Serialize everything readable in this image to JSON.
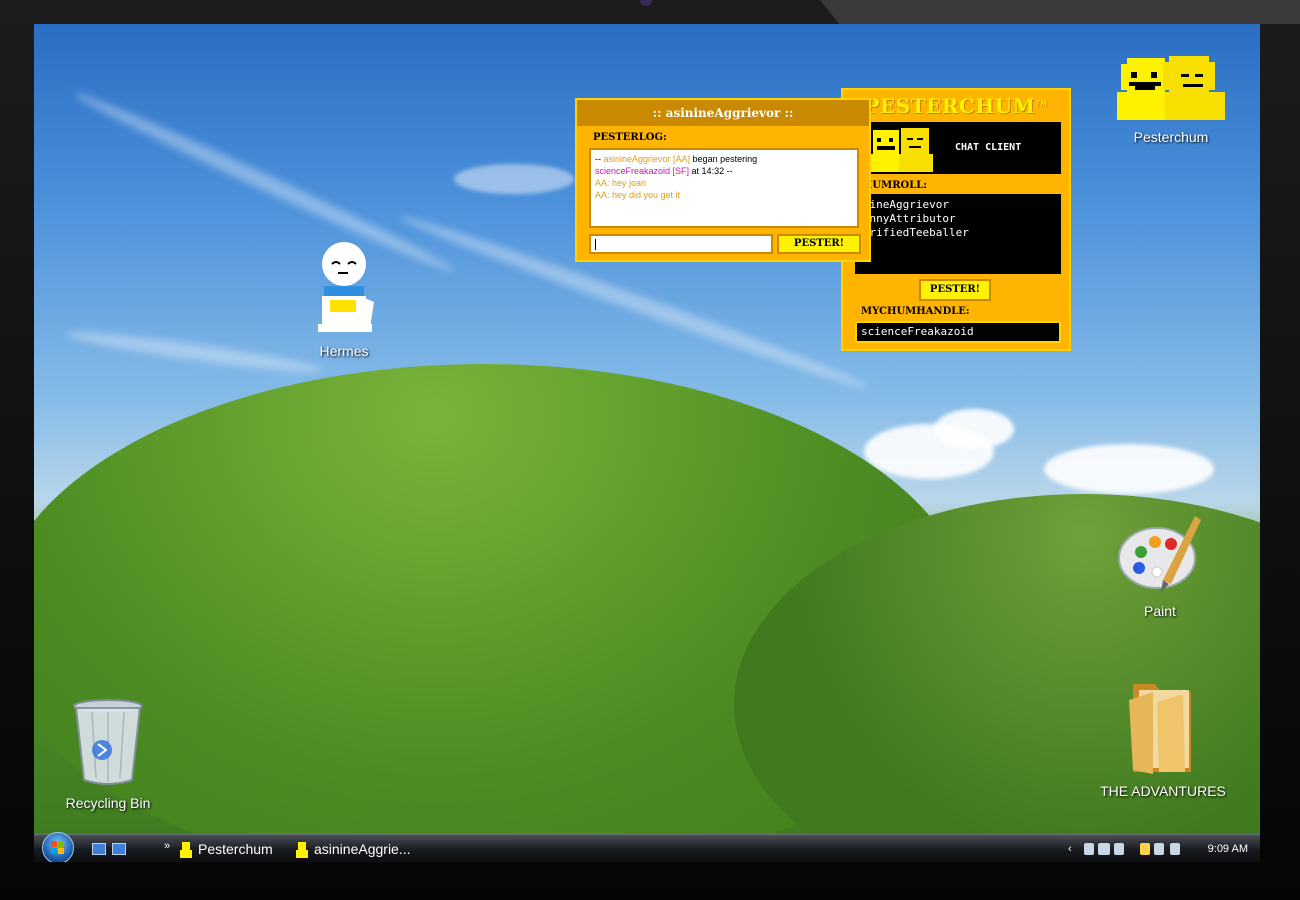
{
  "desktop": {
    "icons": [
      {
        "label": "Pesterchum",
        "icon": "pesterchum-icon"
      },
      {
        "label": "Hermes",
        "icon": "hermes-icon"
      },
      {
        "label": "Paint",
        "icon": "paint-palette-icon"
      },
      {
        "label": "Recycling Bin",
        "icon": "recycle-bin-icon"
      },
      {
        "label": "THE ADVANTURES",
        "icon": "folder-icon"
      }
    ]
  },
  "pesterchum": {
    "title": "PESTERCHUM",
    "title_tm": "TM",
    "subtitle": "CHAT CLIENT",
    "chumroll_label": "CHUMROLL:",
    "chums": [
      "asinineAggrievor",
      "uncannyAttributor",
      "centrifiedTeeballer"
    ],
    "pester_label": "PESTER!",
    "mychumhandle_label": "MYCHUMHANDLE:",
    "handle": "scienceFreakazoid"
  },
  "conversation": {
    "title": ":: asinineAggrievor ::",
    "pesterlog_label": "PESTERLOG:",
    "log": {
      "line1_prefix": "-- ",
      "line1_handle": "asinineAggrievor [AA]",
      "line1_text": " began pestering",
      "line2_handle": "scienceFreakazoid [SF]",
      "line2_text": " at 14:32 --",
      "msg1": "AA: hey joan",
      "msg2": "AA: hey did you get it"
    },
    "input_value": "",
    "pester_label": "PESTER!"
  },
  "taskbar": {
    "chevron": "»",
    "items": [
      {
        "label": "Pesterchum"
      },
      {
        "label": "asinineAggrie..."
      }
    ],
    "tray_arrow": "‹",
    "clock": "9:09 AM"
  },
  "colors": {
    "pesterchum_orange": "#ffb400",
    "pesterchum_yellow": "#fff200",
    "aa_color": "#e0a010",
    "sf_color": "#c020b0"
  }
}
